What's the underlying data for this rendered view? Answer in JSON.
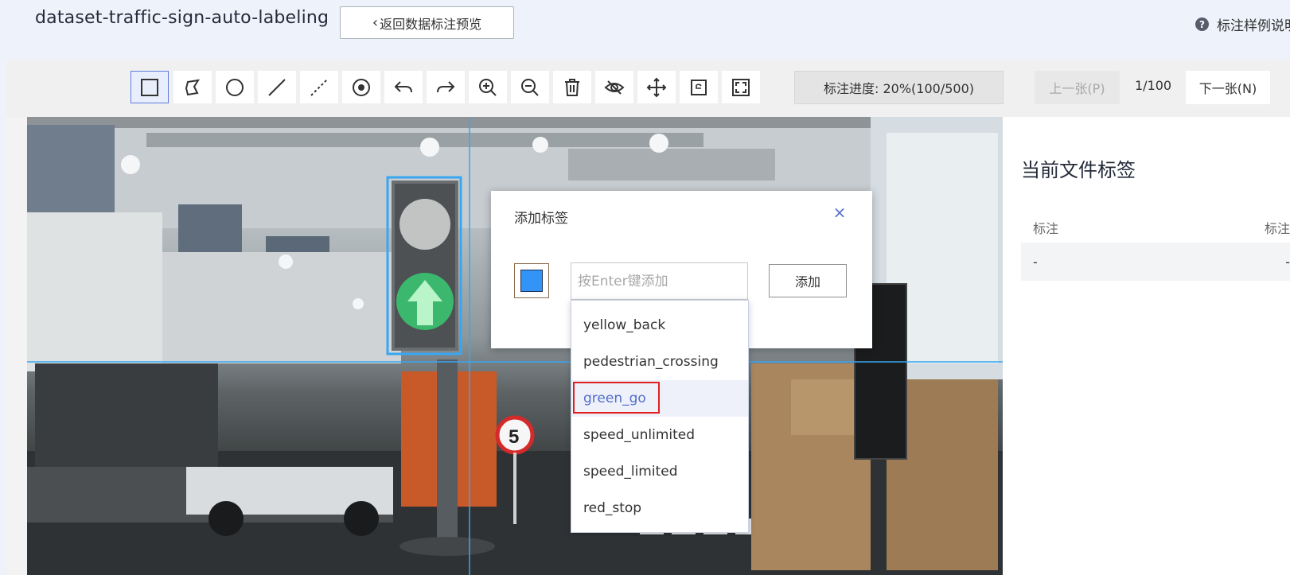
{
  "header": {
    "dataset_title": "dataset-traffic-sign-auto-labeling",
    "back_label": "返回数据标注预览",
    "help_label": "标注样例说明"
  },
  "toolbar": {
    "tools": [
      {
        "name": "rectangle-tool",
        "icon": "rectangle-icon",
        "active": true
      },
      {
        "name": "polygon-tool",
        "icon": "polygon-icon"
      },
      {
        "name": "circle-tool",
        "icon": "circle-icon"
      },
      {
        "name": "line-tool",
        "icon": "line-icon"
      },
      {
        "name": "dashed-line-tool",
        "icon": "dashed-line-icon"
      },
      {
        "name": "point-tool",
        "icon": "point-icon"
      },
      {
        "name": "undo-tool",
        "icon": "undo-icon"
      },
      {
        "name": "redo-tool",
        "icon": "redo-icon"
      },
      {
        "name": "zoom-in-tool",
        "icon": "zoom-in-icon"
      },
      {
        "name": "zoom-out-tool",
        "icon": "zoom-out-icon"
      },
      {
        "name": "delete-tool",
        "icon": "trash-icon"
      },
      {
        "name": "hide-tool",
        "icon": "eye-off-icon"
      },
      {
        "name": "move-tool",
        "icon": "move-icon"
      },
      {
        "name": "reset-tool",
        "icon": "reset-icon"
      },
      {
        "name": "fullscreen-tool",
        "icon": "fullscreen-icon"
      }
    ],
    "progress_text": "标注进度: 20%(100/500)",
    "prev_label": "上一张(P)",
    "page_indicator": "1/100",
    "next_label": "下一张(N)"
  },
  "dialog": {
    "title": "添加标签",
    "close_icon": "×",
    "swatch_color": "#3394f7",
    "input_placeholder": "按Enter键添加",
    "input_value": "",
    "add_label": "添加"
  },
  "dropdown": {
    "items": [
      "yellow_back",
      "pedestrian_crossing",
      "green_go",
      "speed_unlimited",
      "speed_limited",
      "red_stop"
    ],
    "hovered": "green_go"
  },
  "panel": {
    "title": "当前文件标签",
    "col1": "标注",
    "col2": "标注",
    "row_col1": "-",
    "row_col2": "-"
  },
  "image": {
    "speed_sign_text": "5"
  },
  "colors": {
    "accent": "#5e7ce0",
    "selection_box": "#39a6f0",
    "highlight_border": "#e02020"
  }
}
